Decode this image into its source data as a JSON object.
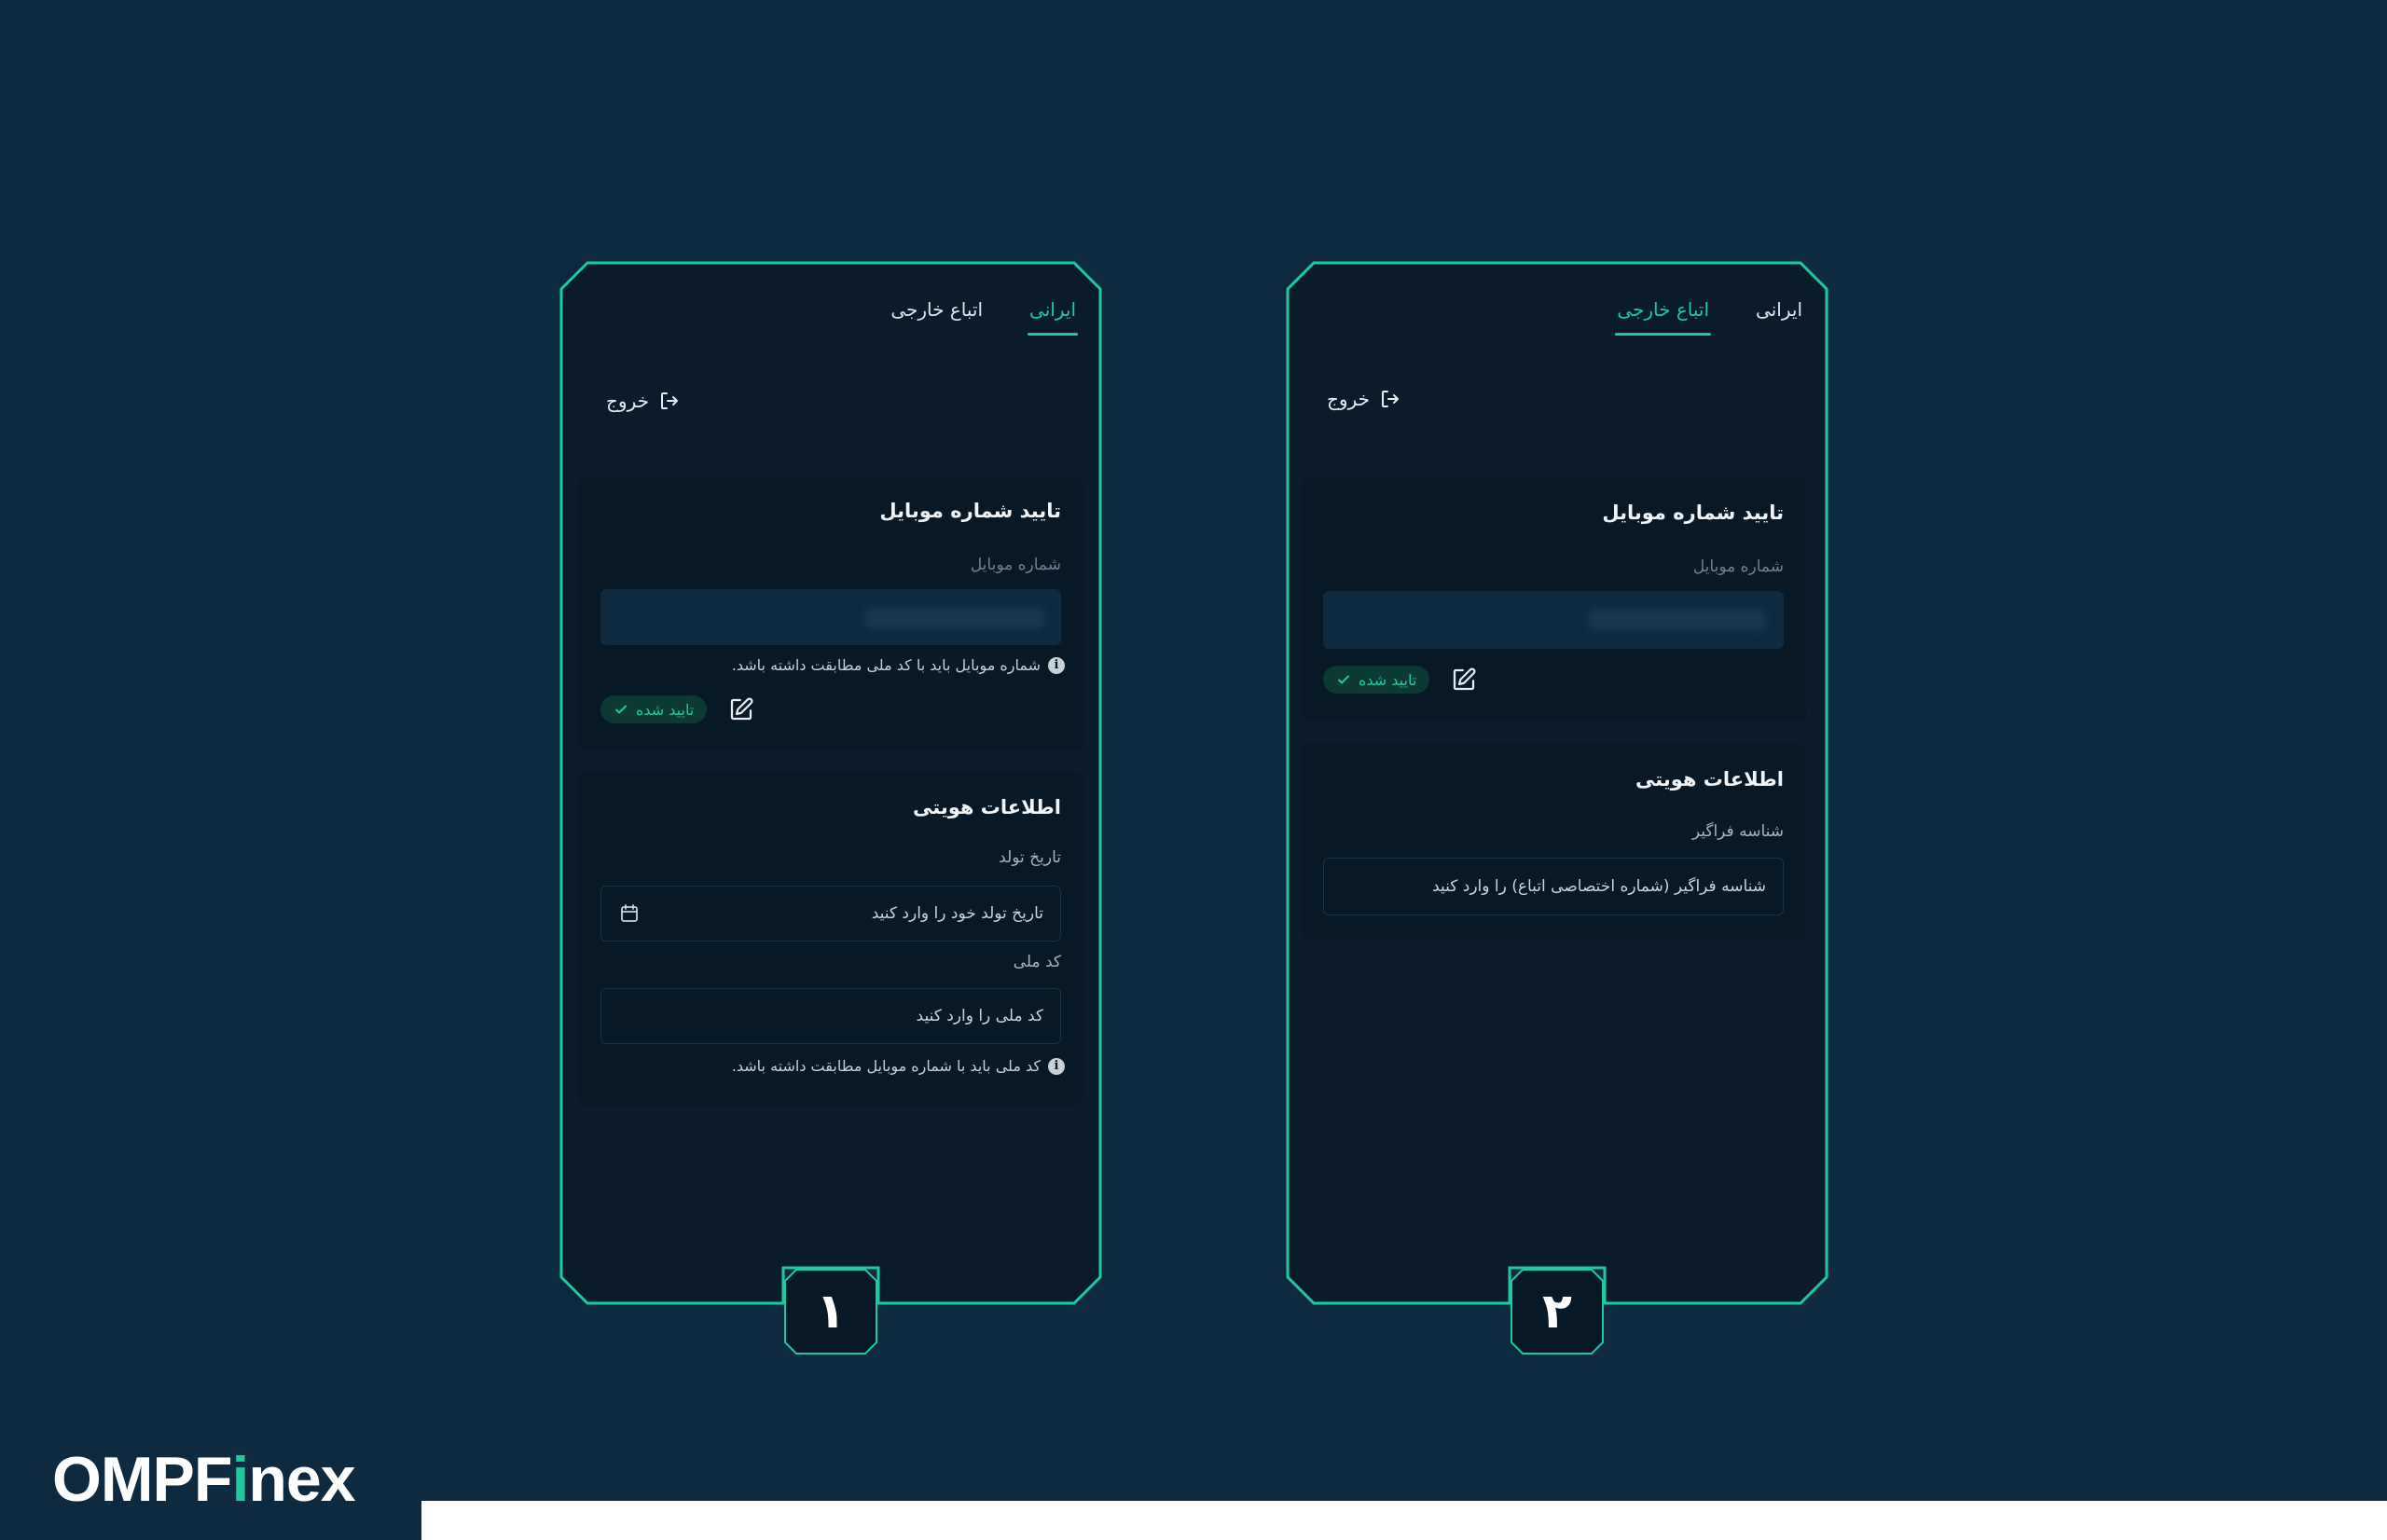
{
  "colors": {
    "background": "#0e2a40",
    "card": "#071826",
    "phone": "#0a1c2c",
    "accent": "#1ec9a0",
    "badge_bg": "#0b3a35"
  },
  "phone1": {
    "tabs": [
      {
        "label": "ایرانی",
        "active": true
      },
      {
        "label": "اتباع خارجی",
        "active": false
      }
    ],
    "logout_label": "خروج",
    "mobile_card": {
      "title": "تایید شماره موبایل",
      "field_label": "شماره موبایل",
      "hint": "شماره موبایل باید با کد ملی مطابقت داشته باشد.",
      "badge": "تایید شده"
    },
    "identity_card": {
      "title": "اطلاعات هویتی",
      "birth_label": "تاریخ تولد",
      "birth_placeholder": "تاریخ تولد خود را وارد کنید",
      "national_label": "کد ملی",
      "national_placeholder": "کد ملی را وارد کنید",
      "hint": "کد ملی باید با شماره موبایل مطابقت داشته باشد."
    },
    "number": "١"
  },
  "phone2": {
    "tabs": [
      {
        "label": "ایرانی",
        "active": false
      },
      {
        "label": "اتباع خارجی",
        "active": true
      }
    ],
    "logout_label": "خروج",
    "mobile_card": {
      "title": "تایید شماره موبایل",
      "field_label": "شماره موبایل",
      "badge": "تایید شده"
    },
    "identity_card": {
      "title": "اطلاعات هویتی",
      "id_label": "شناسه فراگیر",
      "id_placeholder": "شناسه فراگیر (شماره اختصاصی اتباع) را وارد کنید"
    },
    "number": "٢"
  },
  "logo": {
    "main": "OMPF",
    "accent_letter": "i",
    "rest": "nex"
  }
}
